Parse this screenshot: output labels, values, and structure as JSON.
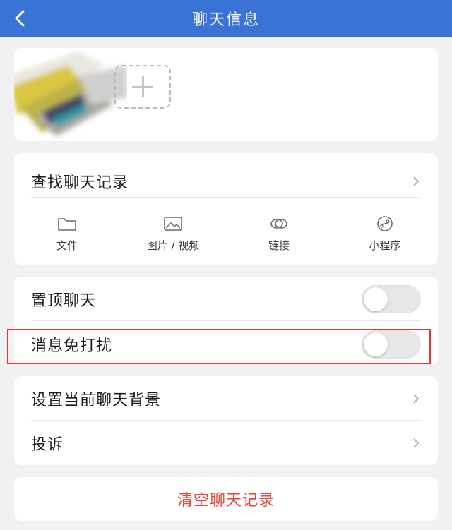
{
  "header": {
    "title": "聊天信息",
    "background_color": "#3a73d6"
  },
  "members": {
    "add_icon": "plus-icon"
  },
  "search_card": {
    "find_history_label": "查找聊天记录",
    "media": [
      {
        "label": "文件",
        "icon": "folder-icon"
      },
      {
        "label": "图片 / 视频",
        "icon": "image-icon"
      },
      {
        "label": "链接",
        "icon": "link-icon"
      },
      {
        "label": "小程序",
        "icon": "mini-program-icon"
      }
    ]
  },
  "toggles": {
    "pin_chat": {
      "label": "置顶聊天",
      "on": false
    },
    "mute": {
      "label": "消息免打扰",
      "on": false
    }
  },
  "settings": {
    "background_label": "设置当前聊天背景",
    "complain_label": "投诉"
  },
  "clear": {
    "label": "清空聊天记录",
    "color": "#e0473c"
  },
  "highlight_color": "#e0373a"
}
